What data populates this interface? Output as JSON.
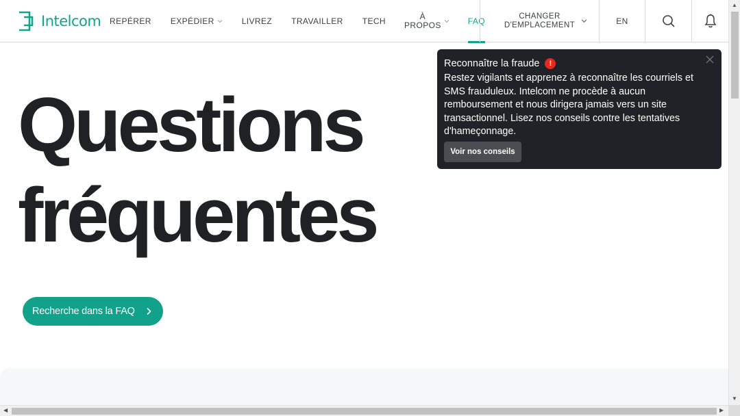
{
  "brand": {
    "name": "Intelcom",
    "color": "#0fa58c"
  },
  "nav": {
    "items": [
      {
        "label": "REPÉRER"
      },
      {
        "label": "EXPÉDIER"
      },
      {
        "label": "LIVREZ"
      },
      {
        "label": "TRAVAILLER"
      },
      {
        "label": "TECH"
      },
      {
        "label_line1": "À",
        "label_line2": "PROPOS"
      },
      {
        "label": "FAQ",
        "active": true
      }
    ]
  },
  "header": {
    "location_line1": "CHANGER",
    "location_line2": "D'EMPLACEMENT",
    "language": "EN",
    "icons": [
      "search-icon",
      "bell-icon"
    ]
  },
  "hero": {
    "title_line1": "Questions",
    "title_line2": "fréquentes",
    "search_button_label": "Recherche dans la FAQ"
  },
  "toast": {
    "title": "Reconnaître la fraude",
    "warning_glyph": "!",
    "body": "Restez vigilants et apprenez à reconnaître les courriels et SMS frauduleux. Intelcom ne procède à aucun remboursement et nous dirigera jamais vers un site transactionnel. Lisez nos conseils contre les tentatives d'hameçonnage.",
    "button_label": "Voir nos conseils",
    "warning_color": "#e5291c"
  }
}
